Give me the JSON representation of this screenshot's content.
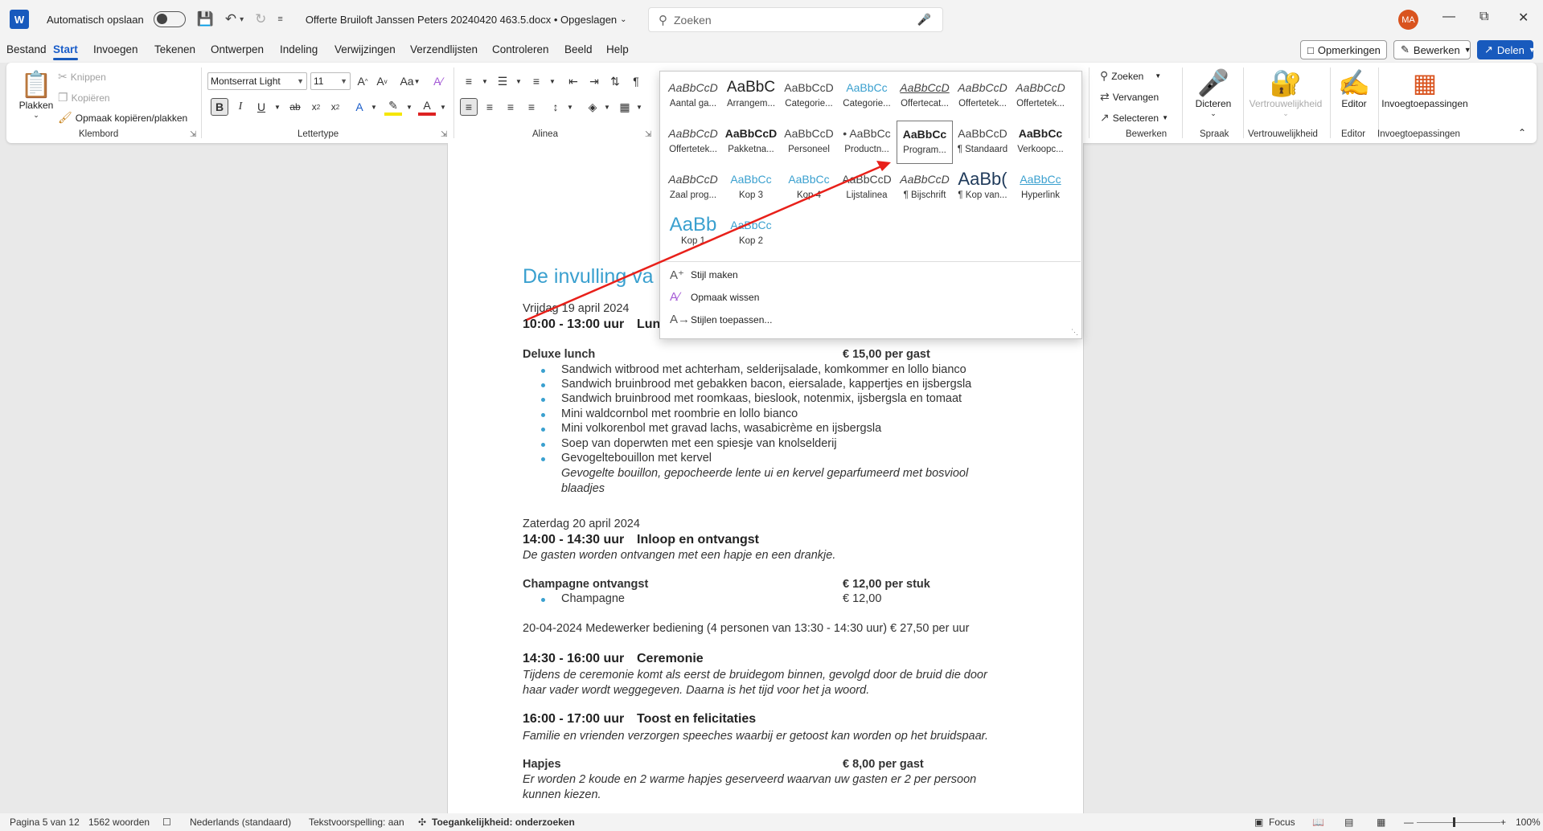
{
  "titlebar": {
    "app_icon": "W",
    "autosave_label": "Automatisch opslaan",
    "doc_title": "Offerte Bruiloft Janssen   Peters 20240420 463.5.docx  •  Opgeslagen",
    "search_placeholder": "Zoeken",
    "avatar_initials": "MA"
  },
  "menu": {
    "tabs": [
      "Bestand",
      "Start",
      "Invoegen",
      "Tekenen",
      "Ontwerpen",
      "Indeling",
      "Verwijzingen",
      "Verzendlijsten",
      "Controleren",
      "Beeld",
      "Help"
    ],
    "comments_button": "Opmerkingen",
    "edit_button": "Bewerken",
    "share_button": "Delen"
  },
  "ribbon": {
    "clipboard": {
      "paste": "Plakken",
      "cut": "Knippen",
      "copy": "Kopiëren",
      "format_painter": "Opmaak kopiëren/plakken",
      "label": "Klembord"
    },
    "font": {
      "name": "Montserrat Light",
      "size": "11",
      "label": "Lettertype"
    },
    "paragraph": {
      "label": "Alinea"
    },
    "editing": {
      "find": "Zoeken",
      "replace": "Vervangen",
      "select": "Selecteren",
      "label": "Bewerken"
    },
    "voice": {
      "dictate": "Dicteren",
      "label": "Spraak"
    },
    "privacy": {
      "sensitivity": "Vertrouwelijkheid",
      "label": "Vertrouwelijkheid"
    },
    "editor": {
      "editor": "Editor",
      "label": "Editor"
    },
    "addins": {
      "addins": "Invoegtoepassingen",
      "label": "Invoegtoepassingen"
    }
  },
  "styles_gallery": {
    "rows": [
      [
        {
          "preview": "AaBbCcD",
          "name": "Aantal ga..."
        },
        {
          "preview": "AaBbC",
          "name": "Arrangem..."
        },
        {
          "preview": "AaBbCcD",
          "name": "Categorie..."
        },
        {
          "preview": "AaBbCc",
          "name": "Categorie..."
        },
        {
          "preview": "AaBbCcD",
          "name": "Offertecat..."
        },
        {
          "preview": "AaBbCcD",
          "name": "Offertetek..."
        },
        {
          "preview": "AaBbCcD",
          "name": "Offertetek..."
        }
      ],
      [
        {
          "preview": "AaBbCcD",
          "name": "Offertetek..."
        },
        {
          "preview": "AaBbCcD",
          "name": "Pakketna..."
        },
        {
          "preview": "AaBbCcD",
          "name": "Personeel"
        },
        {
          "preview": "• AaBbCc",
          "name": "Productn..."
        },
        {
          "preview": "AaBbCc",
          "name": "Program..."
        },
        {
          "preview": "AaBbCcD",
          "name": "¶ Standaard"
        },
        {
          "preview": "AaBbCc",
          "name": "Verkoopc..."
        }
      ],
      [
        {
          "preview": "AaBbCcD",
          "name": "Zaal prog..."
        },
        {
          "preview": "AaBbCc",
          "name": "Kop 3"
        },
        {
          "preview": "AaBbCc",
          "name": "Kop 4"
        },
        {
          "preview": "AaBbCcD",
          "name": "Lijstalinea"
        },
        {
          "preview": "AaBbCcD",
          "name": "¶ Bijschrift"
        },
        {
          "preview": "AaBb(",
          "name": "¶ Kop van..."
        },
        {
          "preview": "AaBbCc",
          "name": "Hyperlink"
        }
      ],
      [
        {
          "preview": "AaBb",
          "name": "Kop 1"
        },
        {
          "preview": "AaBbCc",
          "name": "Kop 2"
        }
      ]
    ],
    "commands": [
      "Stijl maken",
      "Opmaak wissen",
      "Stijlen toepassen..."
    ]
  },
  "document": {
    "heading": "De invulling va",
    "friday": "Vrijdag 19 april 2024",
    "lunch_time": "10:00 - 13:00 uur",
    "lunch_title": "Lun",
    "deluxe": "Deluxe lunch",
    "deluxe_price": "€ 15,00 per gast",
    "lunch_items": [
      "Sandwich witbrood met achterham, selderijsalade, komkommer en lollo bianco",
      "Sandwich bruinbrood met gebakken bacon, eiersalade, kappertjes en ijsbergsla",
      "Sandwich bruinbrood met roomkaas, bieslook, notenmix, ijsbergsla en tomaat",
      "Mini waldcornbol met roombrie en lollo bianco",
      "Mini volkorenbol met gravad lachs, wasabicrème en ijsbergsla",
      "Soep van doperwten met een spiesje van knolselderij",
      "Gevogeltebouillon met kervel"
    ],
    "bouillon_note_1": "Gevogelte bouillon, gepocheerde lente ui en kervel geparfumeerd met bosviool",
    "bouillon_note_2": "blaadjes",
    "saturday": "Zaterdag 20 april 2024",
    "reception_time": "14:00 - 14:30 uur",
    "reception_title": "Inloop en ontvangst",
    "reception_note": "De gasten worden ontvangen met een hapje en een drankje.",
    "champagne_head": "Champagne ontvangst",
    "champagne_head_price": "€ 12,00 per stuk",
    "champagne_item": "Champagne",
    "champagne_price": "€ 12,00",
    "staff_line": "20-04-2024 Medewerker bediening (4 personen van 13:30 - 14:30  uur)      € 27,50 per uur",
    "ceremony_time": "14:30 - 16:00 uur",
    "ceremony_title": "Ceremonie",
    "ceremony_note_1": "Tijdens de ceremonie komt als eerst de bruidegom binnen, gevolgd door de bruid die door",
    "ceremony_note_2": "haar vader wordt weggegeven. Daarna is het tijd voor het ja woord.",
    "toast_time": "16:00 - 17:00 uur",
    "toast_title": "Toost en felicitaties",
    "toast_note": "Familie en vrienden verzorgen speeches waarbij er getoost kan worden op het bruidspaar.",
    "snacks": "Hapjes",
    "snacks_price": "€ 8,00 per gast",
    "snacks_note_1": "Er worden 2 koude en 2 warme hapjes geserveerd waarvan uw gasten er 2 per persoon",
    "snacks_note_2": "kunnen kiezen."
  },
  "statusbar": {
    "page": "Pagina 5 van 12",
    "words": "1562 woorden",
    "language": "Nederlands (standaard)",
    "predictions": "Tekstvoorspelling: aan",
    "accessibility": "Toegankelijkheid: onderzoeken",
    "focus": "Focus",
    "zoom": "100%"
  },
  "colors": {
    "accent": "#185abd",
    "heading": "#3aa0cf",
    "annotation_arrow": "#e8201a"
  }
}
